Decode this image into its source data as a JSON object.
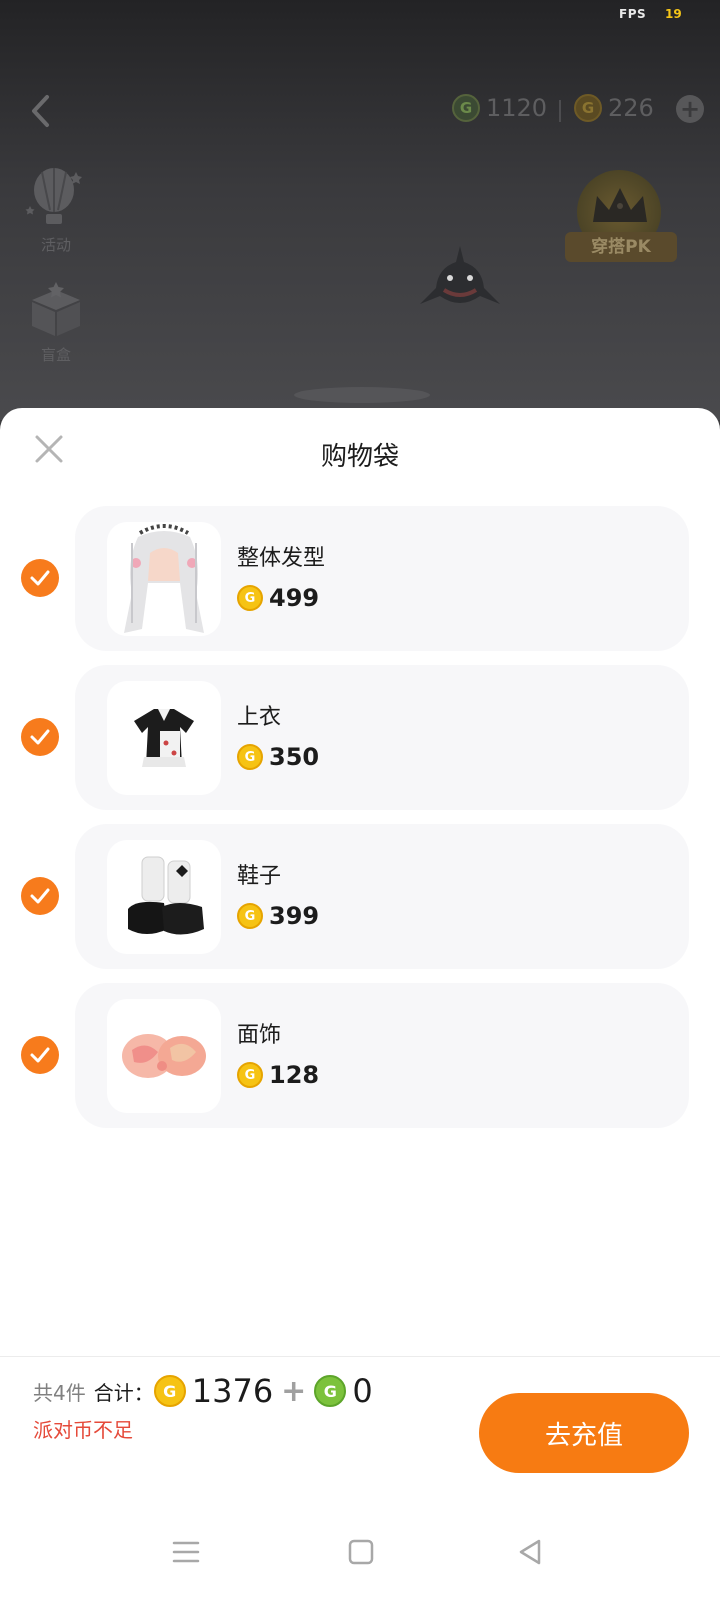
{
  "status": {
    "fps_label": "FPS",
    "fps_value": "19"
  },
  "header": {
    "currency_green": "1120",
    "currency_gold": "226",
    "green_coin_glyph": "G",
    "gold_coin_glyph": "G",
    "plus_glyph": "+"
  },
  "side": {
    "activity_label": "活动",
    "blindbox_label": "盲盒"
  },
  "pk_badge": {
    "label": "穿搭PK"
  },
  "sheet": {
    "title": "购物袋",
    "items": [
      {
        "name": "整体发型",
        "price": "499",
        "checked": true
      },
      {
        "name": "上衣",
        "price": "350",
        "checked": true
      },
      {
        "name": "鞋子",
        "price": "399",
        "checked": true
      },
      {
        "name": "面饰",
        "price": "128",
        "checked": true
      }
    ]
  },
  "summary": {
    "count": "共4件",
    "total_label": "合计：",
    "gold_total": "1376",
    "plus": "+",
    "green_total": "0",
    "warning": "派对币不足"
  },
  "actions": {
    "recharge_label": "去充值"
  },
  "colors": {
    "accent": "#f77b12",
    "check": "#f77b1c",
    "warning": "#e54a3a",
    "gold_coin": "#f6c314",
    "green_coin": "#7cc23c"
  },
  "icons": [
    "back-icon",
    "balloon-icon",
    "gift-box-icon",
    "crown-icon",
    "shark-icon",
    "close-icon",
    "check-icon",
    "gold-coin-icon",
    "green-coin-icon",
    "menu-icon",
    "home-icon",
    "back-triangle-icon"
  ]
}
